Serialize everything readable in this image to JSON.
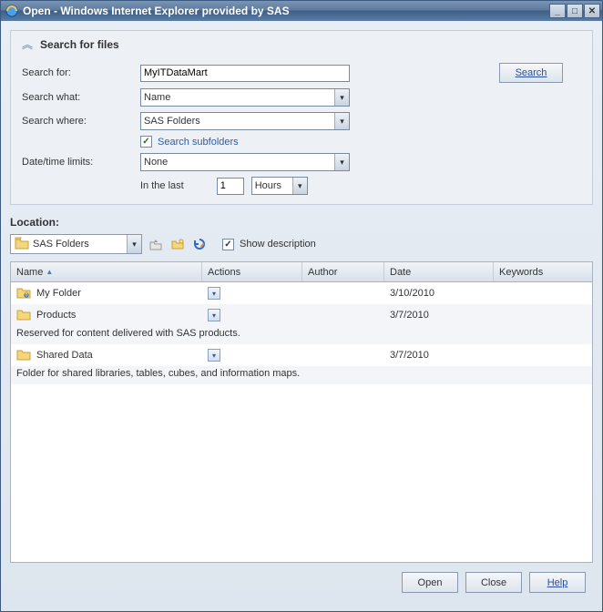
{
  "window": {
    "title": "Open - Windows Internet Explorer provided by SAS"
  },
  "search": {
    "header": "Search for files",
    "for_label": "Search for:",
    "for_value": "MyITDataMart",
    "what_label": "Search what:",
    "what_value": "Name",
    "where_label": "Search where:",
    "where_value": "SAS Folders",
    "subfolders_label": "Search subfolders",
    "subfolders_checked": true,
    "date_label": "Date/time limits:",
    "date_value": "None",
    "inlast_label": "In the last",
    "inlast_value": "1",
    "inlast_unit": "Hours",
    "button": "Search"
  },
  "location": {
    "label": "Location:",
    "current": "SAS Folders",
    "show_desc_label": "Show description",
    "show_desc_checked": true
  },
  "table": {
    "headers": {
      "name": "Name",
      "actions": "Actions",
      "author": "Author",
      "date": "Date",
      "keywords": "Keywords"
    },
    "rows": [
      {
        "name": "My Folder",
        "date": "3/10/2010",
        "folder_type": "user",
        "desc": ""
      },
      {
        "name": "Products",
        "date": "3/7/2010",
        "folder_type": "plain",
        "desc": "Reserved for content delivered with SAS products."
      },
      {
        "name": "Shared Data",
        "date": "3/7/2010",
        "folder_type": "plain",
        "desc": "Folder for shared libraries, tables, cubes, and information maps."
      }
    ]
  },
  "footer": {
    "open": "Open",
    "close": "Close",
    "help": "Help"
  }
}
